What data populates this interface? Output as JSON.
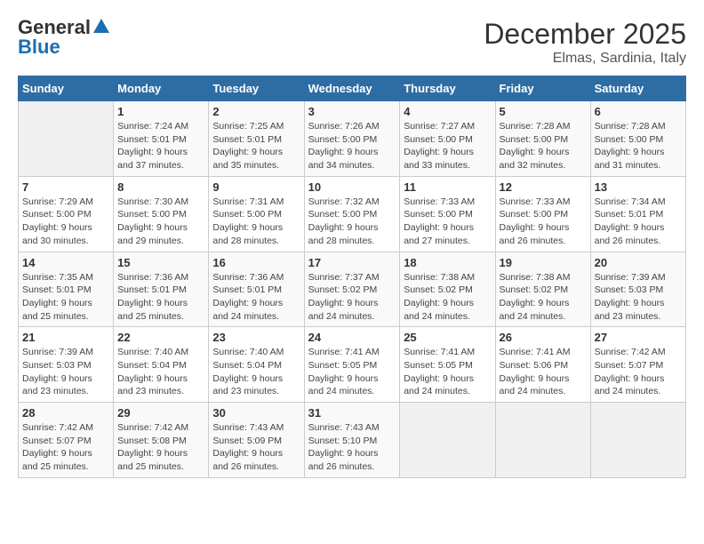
{
  "logo": {
    "general": "General",
    "blue": "Blue"
  },
  "title": {
    "month": "December 2025",
    "location": "Elmas, Sardinia, Italy"
  },
  "days_of_week": [
    "Sunday",
    "Monday",
    "Tuesday",
    "Wednesday",
    "Thursday",
    "Friday",
    "Saturday"
  ],
  "weeks": [
    [
      {
        "day": "",
        "info": ""
      },
      {
        "day": "1",
        "info": "Sunrise: 7:24 AM\nSunset: 5:01 PM\nDaylight: 9 hours\nand 37 minutes."
      },
      {
        "day": "2",
        "info": "Sunrise: 7:25 AM\nSunset: 5:01 PM\nDaylight: 9 hours\nand 35 minutes."
      },
      {
        "day": "3",
        "info": "Sunrise: 7:26 AM\nSunset: 5:00 PM\nDaylight: 9 hours\nand 34 minutes."
      },
      {
        "day": "4",
        "info": "Sunrise: 7:27 AM\nSunset: 5:00 PM\nDaylight: 9 hours\nand 33 minutes."
      },
      {
        "day": "5",
        "info": "Sunrise: 7:28 AM\nSunset: 5:00 PM\nDaylight: 9 hours\nand 32 minutes."
      },
      {
        "day": "6",
        "info": "Sunrise: 7:28 AM\nSunset: 5:00 PM\nDaylight: 9 hours\nand 31 minutes."
      }
    ],
    [
      {
        "day": "7",
        "info": "Sunrise: 7:29 AM\nSunset: 5:00 PM\nDaylight: 9 hours\nand 30 minutes."
      },
      {
        "day": "8",
        "info": "Sunrise: 7:30 AM\nSunset: 5:00 PM\nDaylight: 9 hours\nand 29 minutes."
      },
      {
        "day": "9",
        "info": "Sunrise: 7:31 AM\nSunset: 5:00 PM\nDaylight: 9 hours\nand 28 minutes."
      },
      {
        "day": "10",
        "info": "Sunrise: 7:32 AM\nSunset: 5:00 PM\nDaylight: 9 hours\nand 28 minutes."
      },
      {
        "day": "11",
        "info": "Sunrise: 7:33 AM\nSunset: 5:00 PM\nDaylight: 9 hours\nand 27 minutes."
      },
      {
        "day": "12",
        "info": "Sunrise: 7:33 AM\nSunset: 5:00 PM\nDaylight: 9 hours\nand 26 minutes."
      },
      {
        "day": "13",
        "info": "Sunrise: 7:34 AM\nSunset: 5:01 PM\nDaylight: 9 hours\nand 26 minutes."
      }
    ],
    [
      {
        "day": "14",
        "info": "Sunrise: 7:35 AM\nSunset: 5:01 PM\nDaylight: 9 hours\nand 25 minutes."
      },
      {
        "day": "15",
        "info": "Sunrise: 7:36 AM\nSunset: 5:01 PM\nDaylight: 9 hours\nand 25 minutes."
      },
      {
        "day": "16",
        "info": "Sunrise: 7:36 AM\nSunset: 5:01 PM\nDaylight: 9 hours\nand 24 minutes."
      },
      {
        "day": "17",
        "info": "Sunrise: 7:37 AM\nSunset: 5:02 PM\nDaylight: 9 hours\nand 24 minutes."
      },
      {
        "day": "18",
        "info": "Sunrise: 7:38 AM\nSunset: 5:02 PM\nDaylight: 9 hours\nand 24 minutes."
      },
      {
        "day": "19",
        "info": "Sunrise: 7:38 AM\nSunset: 5:02 PM\nDaylight: 9 hours\nand 24 minutes."
      },
      {
        "day": "20",
        "info": "Sunrise: 7:39 AM\nSunset: 5:03 PM\nDaylight: 9 hours\nand 23 minutes."
      }
    ],
    [
      {
        "day": "21",
        "info": "Sunrise: 7:39 AM\nSunset: 5:03 PM\nDaylight: 9 hours\nand 23 minutes."
      },
      {
        "day": "22",
        "info": "Sunrise: 7:40 AM\nSunset: 5:04 PM\nDaylight: 9 hours\nand 23 minutes."
      },
      {
        "day": "23",
        "info": "Sunrise: 7:40 AM\nSunset: 5:04 PM\nDaylight: 9 hours\nand 23 minutes."
      },
      {
        "day": "24",
        "info": "Sunrise: 7:41 AM\nSunset: 5:05 PM\nDaylight: 9 hours\nand 24 minutes."
      },
      {
        "day": "25",
        "info": "Sunrise: 7:41 AM\nSunset: 5:05 PM\nDaylight: 9 hours\nand 24 minutes."
      },
      {
        "day": "26",
        "info": "Sunrise: 7:41 AM\nSunset: 5:06 PM\nDaylight: 9 hours\nand 24 minutes."
      },
      {
        "day": "27",
        "info": "Sunrise: 7:42 AM\nSunset: 5:07 PM\nDaylight: 9 hours\nand 24 minutes."
      }
    ],
    [
      {
        "day": "28",
        "info": "Sunrise: 7:42 AM\nSunset: 5:07 PM\nDaylight: 9 hours\nand 25 minutes."
      },
      {
        "day": "29",
        "info": "Sunrise: 7:42 AM\nSunset: 5:08 PM\nDaylight: 9 hours\nand 25 minutes."
      },
      {
        "day": "30",
        "info": "Sunrise: 7:43 AM\nSunset: 5:09 PM\nDaylight: 9 hours\nand 26 minutes."
      },
      {
        "day": "31",
        "info": "Sunrise: 7:43 AM\nSunset: 5:10 PM\nDaylight: 9 hours\nand 26 minutes."
      },
      {
        "day": "",
        "info": ""
      },
      {
        "day": "",
        "info": ""
      },
      {
        "day": "",
        "info": ""
      }
    ]
  ]
}
